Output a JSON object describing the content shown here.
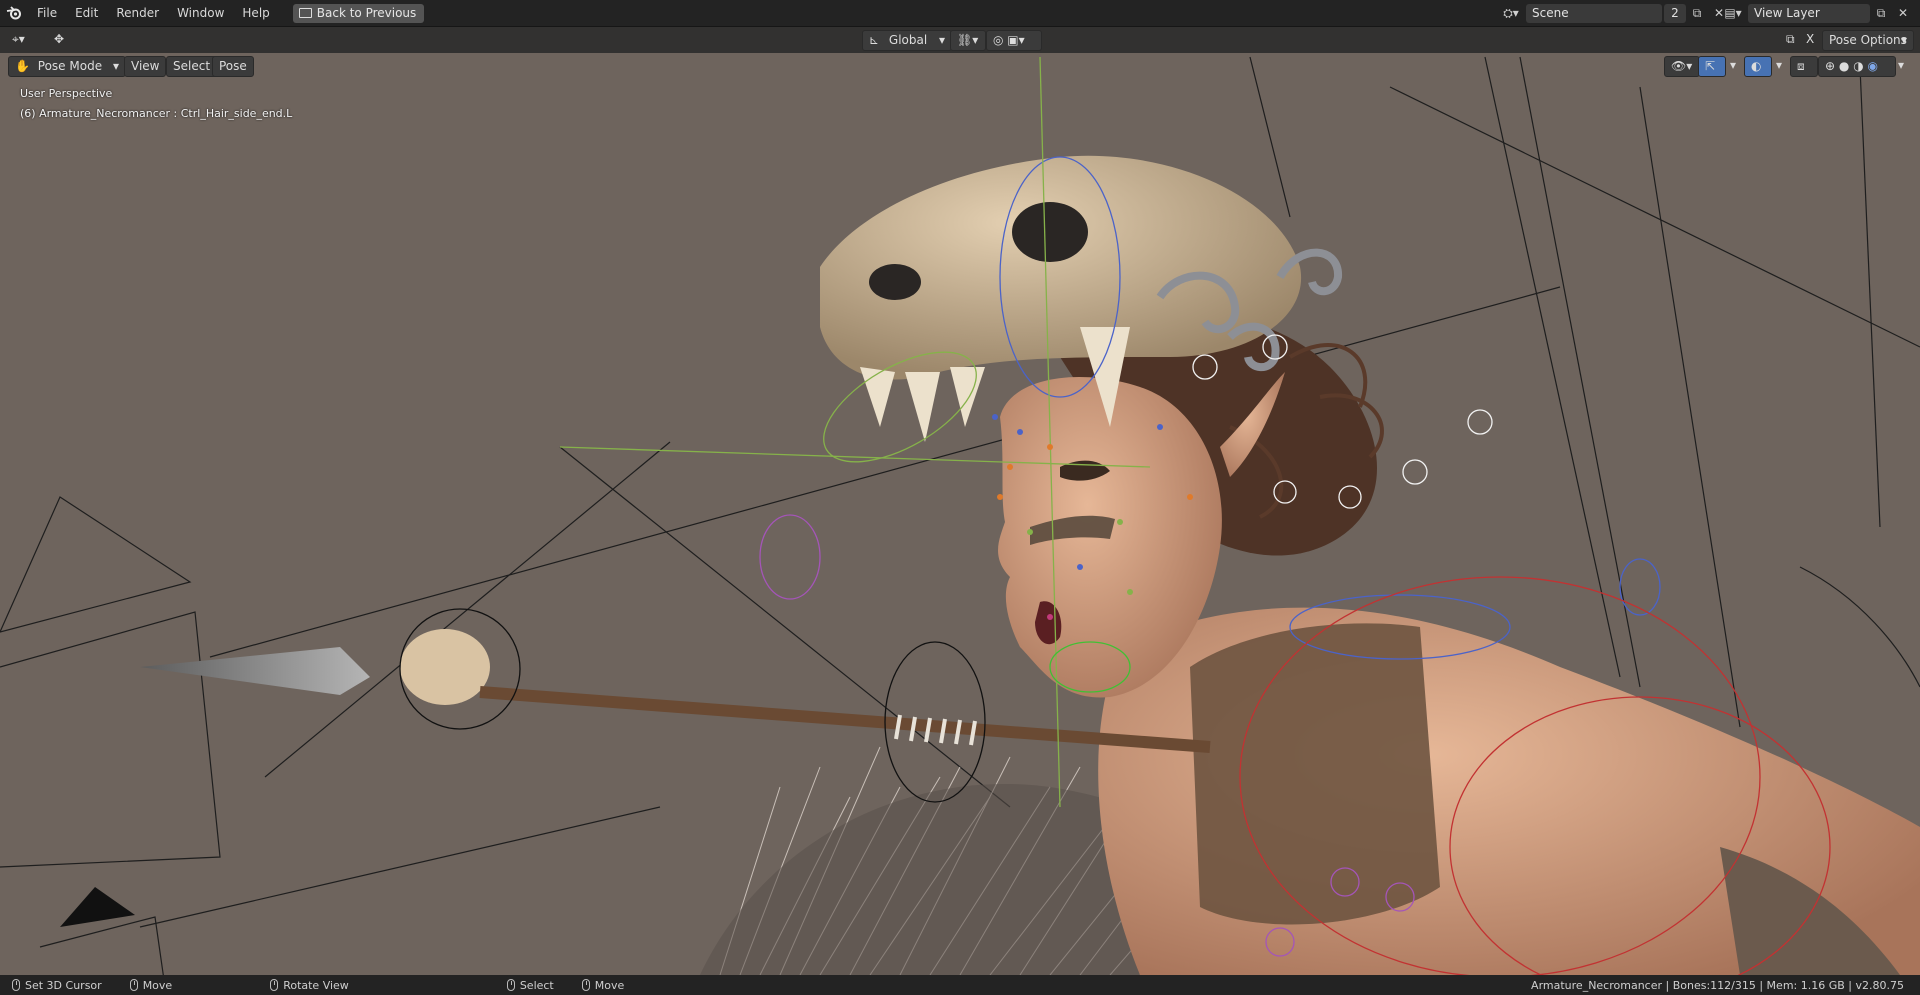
{
  "topbar": {
    "menus": [
      "File",
      "Edit",
      "Render",
      "Window",
      "Help"
    ],
    "back_label": "Back to Previous",
    "scene_name": "Scene",
    "scene_users": "2",
    "view_layer": "View Layer"
  },
  "viewport_header": {
    "transform_orientation": "Global",
    "pose_options_label": "Pose Options",
    "x_label": "X"
  },
  "tool_header": {
    "mode": "Pose Mode",
    "menus": [
      "View",
      "Select",
      "Pose"
    ]
  },
  "overlay": {
    "perspective": "User Perspective",
    "active_object": "(6) Armature_Necromancer : Ctrl_Hair_side_end.L"
  },
  "statusbar": {
    "hint_cursor": "Set 3D Cursor",
    "hint_move": "Move",
    "hint_rotate": "Rotate View",
    "hint_select": "Select",
    "hint_move2": "Move",
    "stats": "Armature_Necromancer | Bones:112/315 | Mem: 1.16 GB | v2.80.75"
  },
  "colors": {
    "viewport_bg": "#6e645d",
    "header_bg": "#232323",
    "accent_blue": "#4772b3"
  },
  "icons": [
    "blender-logo-icon",
    "editor-type-icon",
    "transform-tool-icon",
    "orientation-icon",
    "pivot-icon",
    "snap-icon",
    "proportional-icon",
    "visibility-icon",
    "gizmo-icon",
    "overlay-icon",
    "xray-icon",
    "wireframe-shading-icon",
    "solid-shading-icon",
    "material-shading-icon",
    "rendered-shading-icon"
  ]
}
